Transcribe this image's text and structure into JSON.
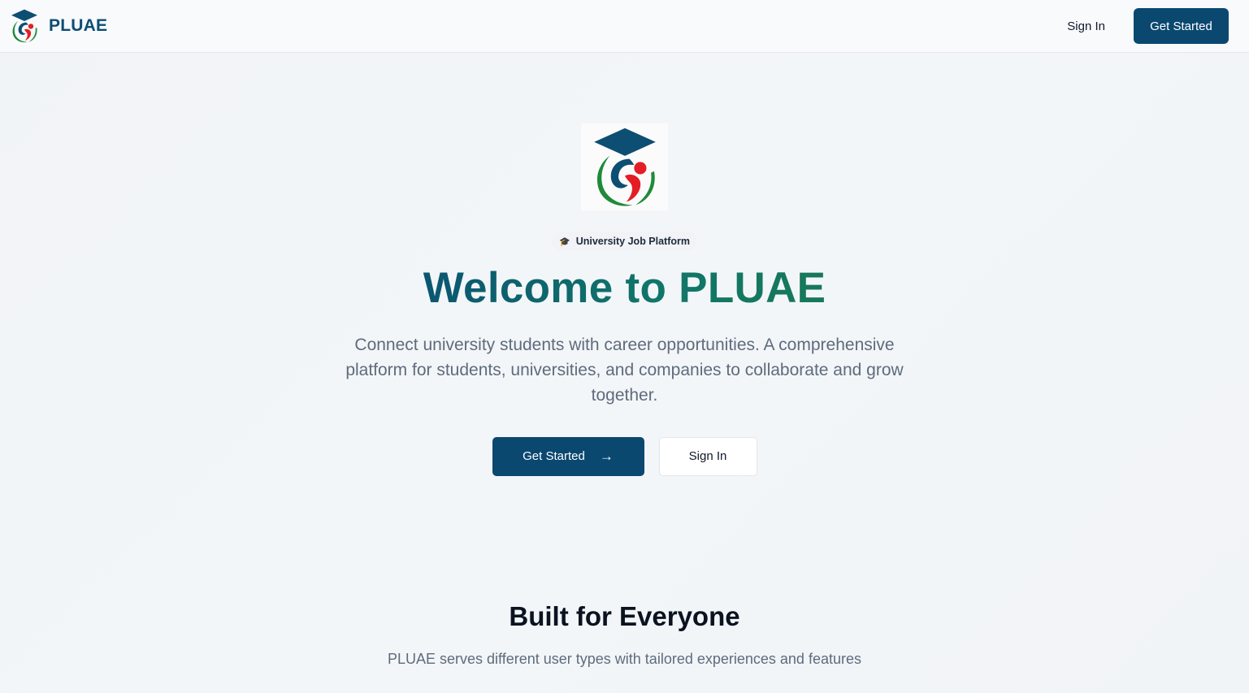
{
  "navbar": {
    "brand_name": "PLUAE",
    "sign_in_label": "Sign In",
    "get_started_label": "Get Started"
  },
  "hero": {
    "badge_icon": "🎓",
    "badge_text": "University Job Platform",
    "title": "Welcome to PLUAE",
    "description": "Connect university students with career opportunities. A comprehensive platform for students, universities, and companies to collaborate and grow together.",
    "primary_button_label": "Get Started",
    "primary_button_icon": "→",
    "secondary_button_label": "Sign In"
  },
  "features": {
    "title": "Built for Everyone",
    "subtitle": "PLUAE serves different user types with tailored experiences and features"
  },
  "colors": {
    "brand_blue": "#0b4870",
    "brand_green": "#17785a",
    "logo_red": "#e31e24",
    "logo_green": "#1f8a3a"
  },
  "icons": {
    "logo": "graduation-cap-person-logo",
    "badge": "graduation-cap-icon",
    "arrow": "arrow-right-icon"
  }
}
